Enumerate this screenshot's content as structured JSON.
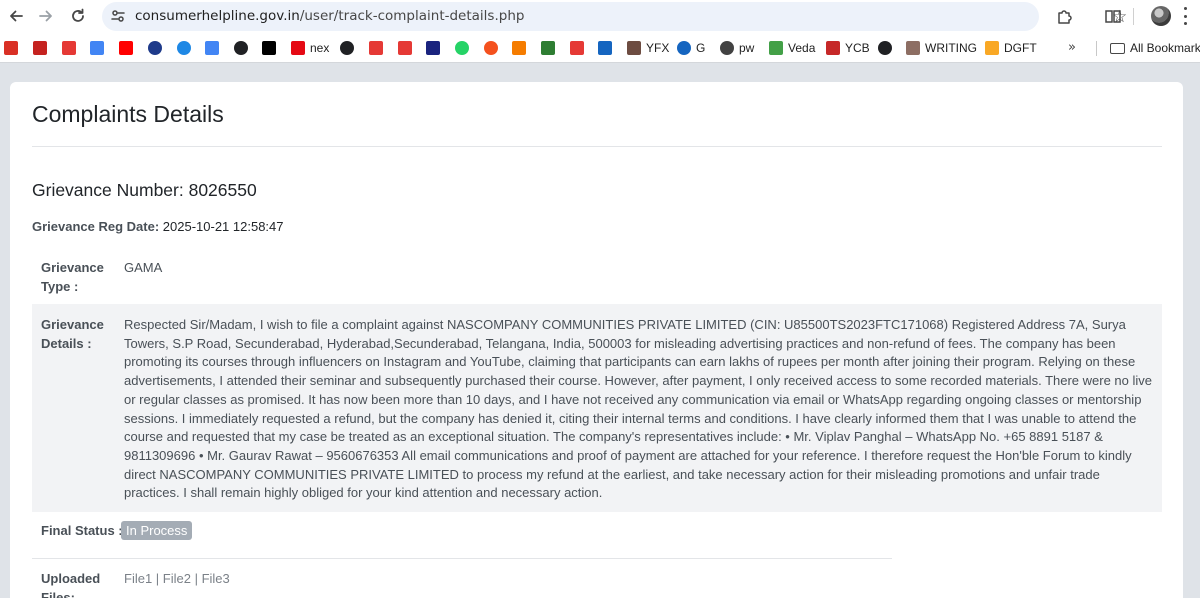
{
  "browser": {
    "url_host": "consumerhelpline.gov.in",
    "url_path": "/user/track-complaint-details.php"
  },
  "bookmarks": {
    "items": [
      {
        "label": "",
        "color": "#d93025",
        "round": false
      },
      {
        "label": "",
        "color": "#c5221f",
        "round": false
      },
      {
        "label": "",
        "color": "#e53935",
        "round": false
      },
      {
        "label": "",
        "color": "#4285f4",
        "round": false
      },
      {
        "label": "",
        "color": "#ff0000",
        "round": false
      },
      {
        "label": "",
        "color": "#1e3a8a",
        "round": true
      },
      {
        "label": "",
        "color": "#1e88e5",
        "round": true
      },
      {
        "label": "",
        "color": "#4285f4",
        "round": false
      },
      {
        "label": "",
        "color": "#202124",
        "round": true
      },
      {
        "label": "",
        "color": "#000000",
        "round": false
      },
      {
        "label": "nex",
        "color": "#e50914",
        "round": false
      },
      {
        "label": "",
        "color": "#202124",
        "round": true
      },
      {
        "label": "",
        "color": "#e53935",
        "round": false
      },
      {
        "label": "",
        "color": "#e53935",
        "round": false
      },
      {
        "label": "",
        "color": "#1a237e",
        "round": false
      },
      {
        "label": "",
        "color": "#25d366",
        "round": true
      },
      {
        "label": "",
        "color": "#f4511e",
        "round": true
      },
      {
        "label": "",
        "color": "#f57c00",
        "round": false
      },
      {
        "label": "",
        "color": "#2e7d32",
        "round": false
      },
      {
        "label": "",
        "color": "#e53935",
        "round": false
      },
      {
        "label": "",
        "color": "#1565c0",
        "round": false
      },
      {
        "label": "YFX",
        "color": "#6d4c41",
        "round": false
      },
      {
        "label": "G",
        "color": "#1565c0",
        "round": true
      },
      {
        "label": "pw",
        "color": "#424242",
        "round": true
      },
      {
        "label": "Veda",
        "color": "#43a047",
        "round": false
      },
      {
        "label": "YCB",
        "color": "#c62828",
        "round": false
      },
      {
        "label": "",
        "color": "#202124",
        "round": true
      },
      {
        "label": "WRITING",
        "color": "#8d6e63",
        "round": false
      },
      {
        "label": "DGFT",
        "color": "#f9a825",
        "round": false
      }
    ],
    "all_bookmarks_label": "All Bookmarks"
  },
  "page": {
    "title": "Complaints Details",
    "grievance_number_label": "Grievance Number: 8026550",
    "reg_date_label": "Grievance Reg Date:",
    "reg_date_value": " 2025-10-21 12:58:47",
    "type_label": "Grievance Type :",
    "type_value": "GAMA",
    "details_label": "Grievance Details :",
    "details_value": "Respected Sir/Madam, I wish to file a complaint against NASCOMPANY COMMUNITIES PRIVATE LIMITED (CIN: U85500TS2023FTC171068) Registered Address 7A, Surya Towers, S.P Road, Secunderabad, Hyderabad,Secunderabad, Telangana, India, 500003 for misleading advertising practices and non-refund of fees. The company has been promoting its courses through influencers on Instagram and YouTube, claiming that participants can earn lakhs of rupees per month after joining their program. Relying on these advertisements, I attended their seminar and subsequently purchased their course. However, after payment, I only received access to some recorded materials. There were no live or regular classes as promised. It has now been more than 10 days, and I have not received any communication via email or WhatsApp regarding ongoing classes or mentorship sessions. I immediately requested a refund, but the company has denied it, citing their internal terms and conditions. I have clearly informed them that I was unable to attend the course and requested that my case be treated as an exceptional situation. The company's representatives include: • Mr. Viplav Panghal – WhatsApp No. +65 8891 5187 & 9811309696 • Mr. Gaurav Rawat – 9560676353 All email communications and proof of payment are attached for your reference. I therefore request the Hon'ble Forum to kindly direct NASCOMPANY COMMUNITIES PRIVATE LIMITED to process my refund at the earliest, and take necessary action for their misleading promotions and unfair trade practices. I shall remain highly obliged for your kind attention and necessary action.",
    "status_label": "Final Status :",
    "status_value": "In Process",
    "files_label": "Uploaded Files:",
    "files": [
      "File1",
      "File2",
      "File3"
    ],
    "files_separator": " | "
  }
}
